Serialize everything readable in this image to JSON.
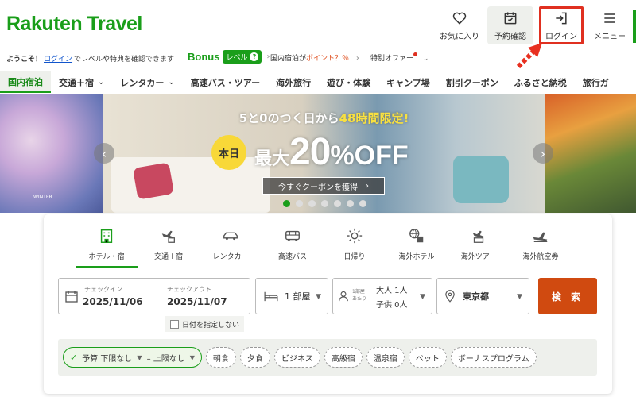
{
  "header": {
    "logo": "Rakuten Travel",
    "favorites_label": "お気に入り",
    "reservation_label": "予約確認",
    "login_label": "ログイン",
    "menu_label": "メニュー"
  },
  "info_bar": {
    "welcome": "ようこそ！",
    "login_link": "ログイン",
    "level_text": "でレベルや特典を確認できます",
    "bonus_word": "Bonus",
    "level_badge": "レベル",
    "level_q": "?",
    "points_prefix": "国内宿泊が",
    "points_highlight": "ポイント？％",
    "special_offer": "特別オファー"
  },
  "categories": [
    {
      "label": "国内宿泊",
      "active": true,
      "dropdown": false
    },
    {
      "label": "交通＋宿",
      "active": false,
      "dropdown": true
    },
    {
      "label": "レンタカー",
      "active": false,
      "dropdown": true
    },
    {
      "label": "高速バス・ツアー",
      "active": false,
      "dropdown": false
    },
    {
      "label": "海外旅行",
      "active": false,
      "dropdown": false
    },
    {
      "label": "遊び・体験",
      "active": false,
      "dropdown": false
    },
    {
      "label": "キャンプ場",
      "active": false,
      "dropdown": false
    },
    {
      "label": "割引クーポン",
      "active": false,
      "dropdown": false
    },
    {
      "label": "ふるさと納税",
      "active": false,
      "dropdown": false
    },
    {
      "label": "旅行ガ",
      "active": false,
      "dropdown": false
    }
  ],
  "banner": {
    "line1_a": "5と0のつく日から",
    "line1_b": "48時間限定!",
    "badge": "本日",
    "big_a": "最大",
    "big_b": "20",
    "big_c": "%OFF",
    "cta": "今すぐクーポンを獲得",
    "side_text": "WINTER",
    "slide_count": 7,
    "active_slide": 1
  },
  "search": {
    "tabs": [
      {
        "label": "ホテル・宿",
        "icon": "hotel-icon",
        "active": true
      },
      {
        "label": "交通＋宿",
        "icon": "plane-hotel-icon",
        "active": false
      },
      {
        "label": "レンタカー",
        "icon": "car-icon",
        "active": false
      },
      {
        "label": "高速バス",
        "icon": "bus-icon",
        "active": false
      },
      {
        "label": "日帰り",
        "icon": "sun-icon",
        "active": false
      },
      {
        "label": "海外ホテル",
        "icon": "globe-hotel-icon",
        "active": false
      },
      {
        "label": "海外ツアー",
        "icon": "plane-tour-icon",
        "active": false
      },
      {
        "label": "海外航空券",
        "icon": "plane-icon",
        "active": false
      }
    ],
    "checkin_label": "チェックイン",
    "checkin_value": "2025/11/06",
    "checkout_label": "チェックアウト",
    "checkout_value": "2025/11/07",
    "rooms_value": "1 部屋",
    "per_room_line1": "1部屋",
    "per_room_line2": "あたり",
    "adults": "大人 1人",
    "children": "子供 0人",
    "location": "東京都",
    "search_button": "検 索",
    "no_date_label": "日付を指定しない",
    "budget": "予算 下限なし",
    "budget_upper": "– 上限なし",
    "filters": [
      "朝食",
      "夕食",
      "ビジネス",
      "高級宿",
      "温泉宿",
      "ペット",
      "ボーナスプログラム"
    ]
  }
}
